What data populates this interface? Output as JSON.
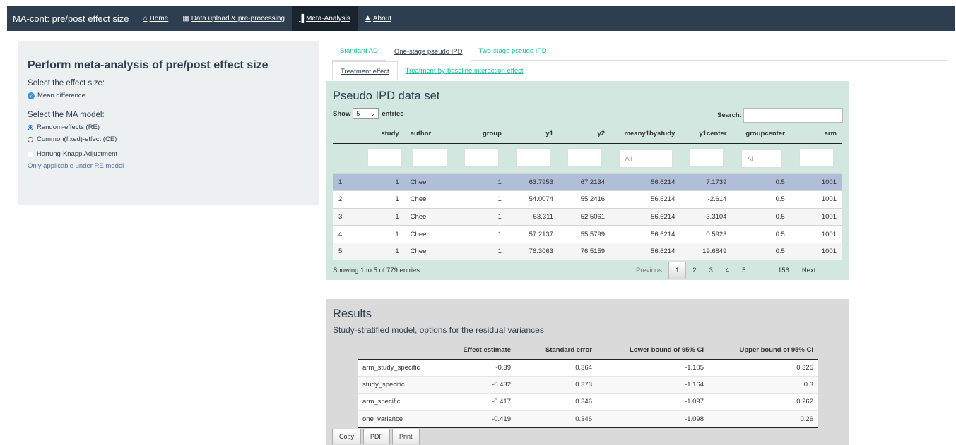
{
  "navbar": {
    "brand": "MA-cont: pre/post effect size",
    "items": [
      {
        "icon": "home-icon",
        "glyph": "⌂",
        "label": "Home"
      },
      {
        "icon": "table-icon",
        "glyph": "▦",
        "label": "Data upload & pre-processing"
      },
      {
        "icon": "bar-chart-icon",
        "glyph": "▐",
        "label": "Meta-Analysis"
      },
      {
        "icon": "users-icon",
        "glyph": "♟",
        "label": "About"
      }
    ]
  },
  "sidebar": {
    "title": "Perform meta-analysis of pre/post effect size",
    "effect_label": "Select the effect size:",
    "effect_option": "Mean difference",
    "model_label": "Select the MA model:",
    "model_options": [
      "Random-effects (RE)",
      "Common(fixed)-effect (CE)"
    ],
    "hk_label": "Hartung-Knapp Adjustment",
    "hk_note": "Only applicable under RE model"
  },
  "tabs_level1": [
    "Standard AD",
    "One-stage pseudo IPD",
    "Two-stage pseudo IPD"
  ],
  "tabs_level2": [
    "Treatment effect",
    "Treatment-by-baseline interaction effect"
  ],
  "ipd": {
    "title": "Pseudo IPD data set",
    "show_label": "Show",
    "show_value": "5",
    "entries_label": "entries",
    "search_label": "Search:",
    "columns": [
      "",
      "study",
      "author",
      "group",
      "y1",
      "y2",
      "meany1bystudy",
      "y1center",
      "groupcenter",
      "arm"
    ],
    "filters": [
      "",
      "",
      "",
      "",
      "",
      "",
      "All",
      "",
      "Al",
      ""
    ],
    "rows": [
      [
        "1",
        "1",
        "Chee",
        "1",
        "63.7953",
        "67.2134",
        "56.6214",
        "7.1739",
        "0.5",
        "1001"
      ],
      [
        "2",
        "1",
        "Chee",
        "1",
        "54.0074",
        "55.2416",
        "56.6214",
        "-2.614",
        "0.5",
        "1001"
      ],
      [
        "3",
        "1",
        "Chee",
        "1",
        "53.311",
        "52.5061",
        "56.6214",
        "-3.3104",
        "0.5",
        "1001"
      ],
      [
        "4",
        "1",
        "Chee",
        "1",
        "57.2137",
        "55.5799",
        "56.6214",
        "0.5923",
        "0.5",
        "1001"
      ],
      [
        "5",
        "1",
        "Chee",
        "1",
        "76.3063",
        "76.5159",
        "56.6214",
        "19.6849",
        "0.5",
        "1001"
      ]
    ],
    "info": "Showing 1 to 5 of 779 entries",
    "pager": [
      "Previous",
      "1",
      "2",
      "3",
      "4",
      "5",
      "…",
      "156",
      "Next"
    ]
  },
  "results": {
    "title": "Results",
    "subtitle": "Study-stratified model, options for the residual variances",
    "columns": [
      "",
      "Effect estimate",
      "Standard error",
      "Lower bound of 95% CI",
      "Upper bound of 95% CI"
    ],
    "rows": [
      [
        "arm_study_specific",
        "-0.39",
        "0.364",
        "-1.105",
        "0.325"
      ],
      [
        "study_specific",
        "-0.432",
        "0.373",
        "-1.164",
        "0.3"
      ],
      [
        "arm_specific",
        "-0.417",
        "0.346",
        "-1.097",
        "0.262"
      ],
      [
        "one_variance",
        "-0.419",
        "0.346",
        "-1.098",
        "0.26"
      ]
    ],
    "buttons": [
      "Copy",
      "PDF",
      "Print"
    ]
  },
  "colors": {
    "navbar": "#2c3e50",
    "accent": "#18bc9c",
    "ipd_panel": "#d1e7e0",
    "selected_row": "#b0bed9"
  }
}
